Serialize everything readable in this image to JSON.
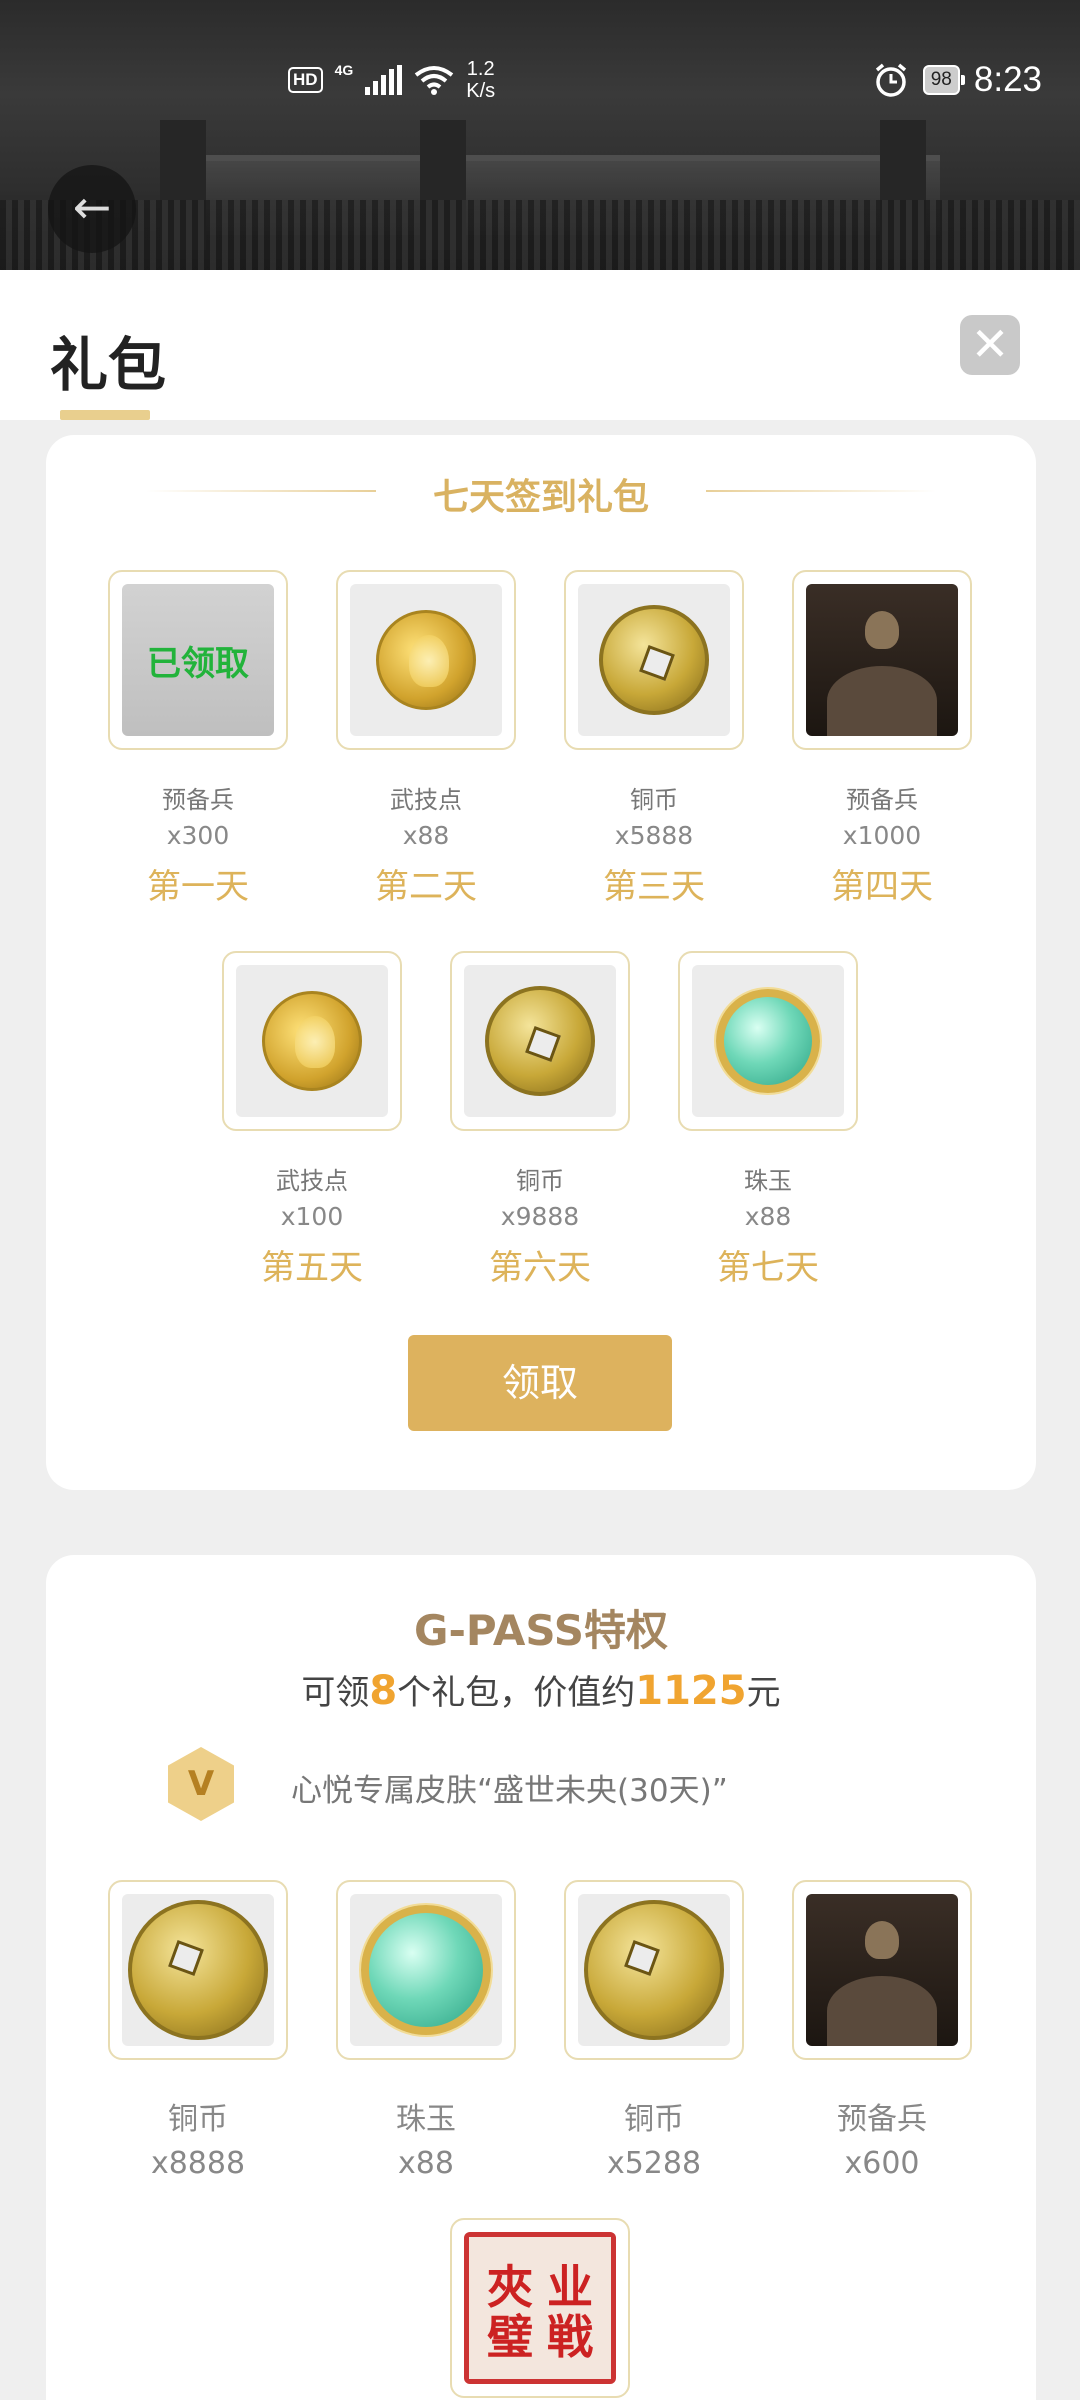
{
  "status_bar": {
    "hd": "HD",
    "signal": "4G",
    "speed_value": "1.2",
    "speed_unit": "K/s",
    "battery": "98",
    "time": "8:23"
  },
  "header": {
    "back_icon": "arrow-left-icon",
    "title": "礼包",
    "close_icon": "close-icon"
  },
  "signin": {
    "title": "七天签到礼包",
    "claimed_label": "已领取",
    "claim_button": "领取",
    "days": [
      {
        "label": "第一天",
        "item": "预备兵",
        "qty": "x300",
        "icon": "reserve-soldier-icon",
        "claimed": true
      },
      {
        "label": "第二天",
        "item": "武技点",
        "qty": "x88",
        "icon": "skill-point-icon",
        "claimed": false
      },
      {
        "label": "第三天",
        "item": "铜币",
        "qty": "x5888",
        "icon": "copper-coin-icon",
        "claimed": false
      },
      {
        "label": "第四天",
        "item": "预备兵",
        "qty": "x1000",
        "icon": "reserve-soldier-icon",
        "claimed": false
      },
      {
        "label": "第五天",
        "item": "武技点",
        "qty": "x100",
        "icon": "skill-point-icon",
        "claimed": false
      },
      {
        "label": "第六天",
        "item": "铜币",
        "qty": "x9888",
        "icon": "copper-coin-icon",
        "claimed": false
      },
      {
        "label": "第七天",
        "item": "珠玉",
        "qty": "x88",
        "icon": "jade-icon",
        "claimed": false
      }
    ]
  },
  "gpass": {
    "title": "G-PASS特权",
    "subtitle_pre": "可领",
    "gift_count": "8",
    "subtitle_mid": "个礼包，价值约",
    "value": "1125",
    "subtitle_post": "元",
    "vip_badge": "V",
    "skin_text": "心悦专属皮肤“盛世未央(30天)”",
    "items": [
      {
        "item": "铜币",
        "qty": "x8888",
        "icon": "copper-coin-icon"
      },
      {
        "item": "珠玉",
        "qty": "x88",
        "icon": "jade-icon"
      },
      {
        "item": "铜币",
        "qty": "x5288",
        "icon": "copper-coin-icon"
      },
      {
        "item": "预备兵",
        "qty": "x600",
        "icon": "reserve-soldier-icon"
      },
      {
        "item": "",
        "qty": "",
        "icon": "red-seal-icon"
      }
    ]
  },
  "colors": {
    "accent_gold": "#ddb25e",
    "highlight_orange": "#f0a430",
    "claimed_green": "#22b33b"
  }
}
